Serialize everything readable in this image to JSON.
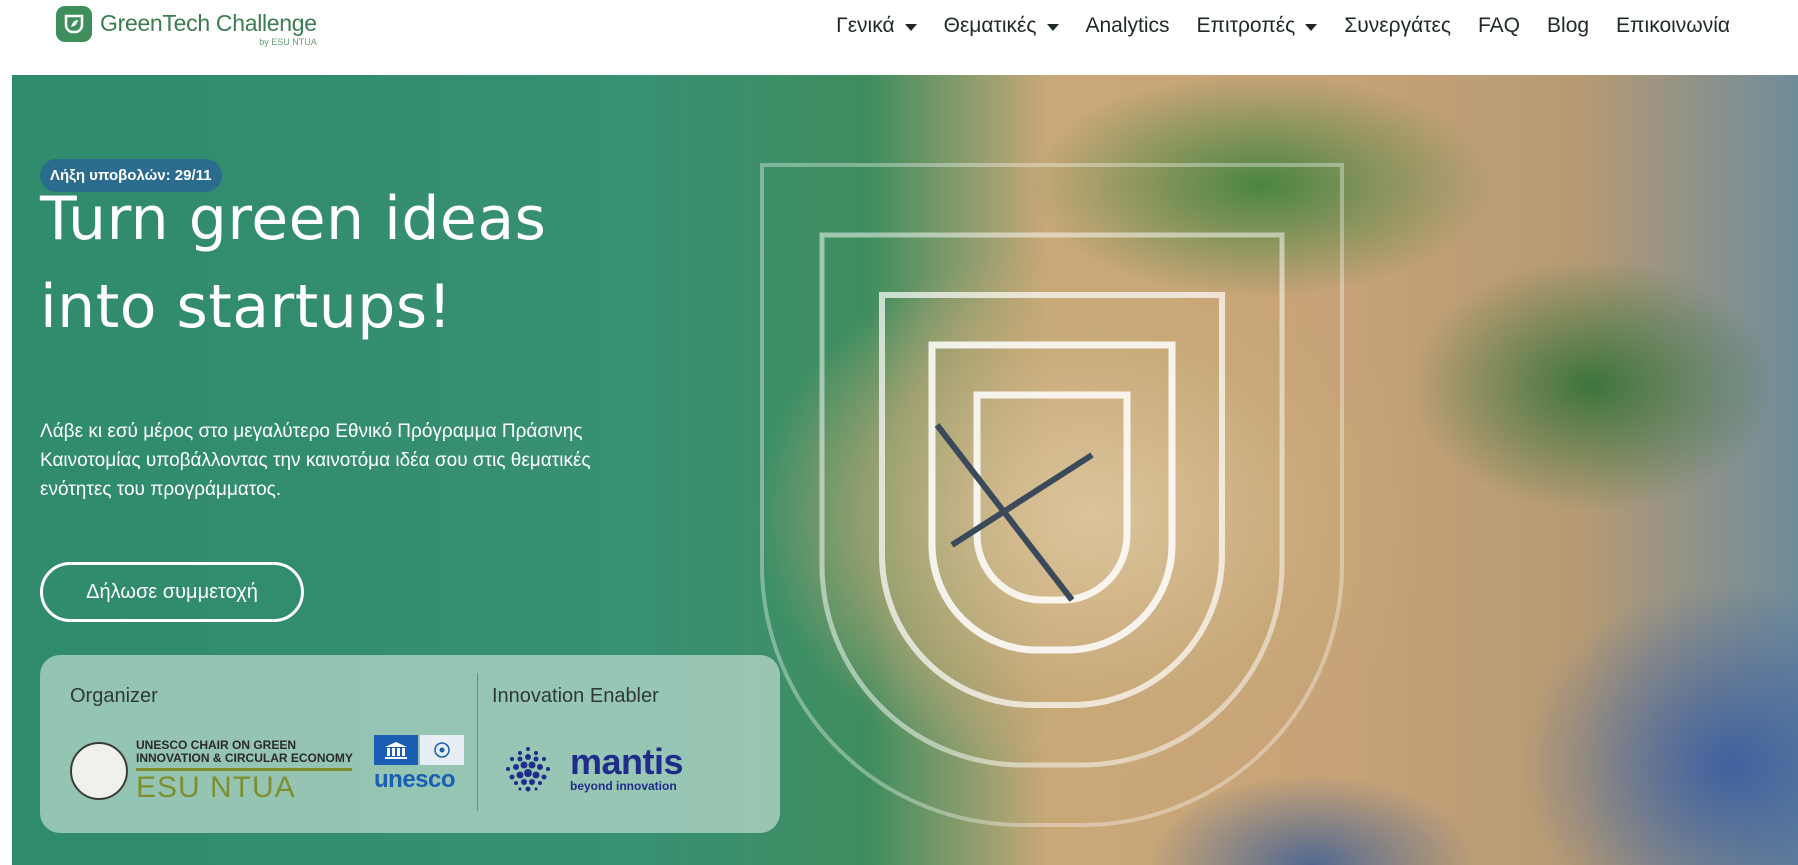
{
  "header": {
    "logo_name": "GreenTech Challenge",
    "logo_sub": "by ESU NTUA",
    "nav": [
      {
        "label": "Γενικά",
        "dropdown": true
      },
      {
        "label": "Θεματικές",
        "dropdown": true
      },
      {
        "label": "Analytics",
        "dropdown": false
      },
      {
        "label": "Επιτροπές",
        "dropdown": true
      },
      {
        "label": "Συνεργάτες",
        "dropdown": false
      },
      {
        "label": "FAQ",
        "dropdown": false
      },
      {
        "label": "Blog",
        "dropdown": false
      },
      {
        "label": "Επικοινωνία",
        "dropdown": false
      }
    ]
  },
  "hero": {
    "badge": "Λήξη υποβολών: 29/11",
    "headline_line1": "Turn green ideas",
    "headline_line2": "into startups!",
    "intro_line1": "Λάβε κι εσύ μέρος στο μεγαλύτερο Εθνικό Πρόγραμμα Πράσινης",
    "intro_line2": "Καινοτομίας υποβάλλοντας την καινοτόμα ιδέα σου στις θεματικές",
    "intro_line3": "ενότητες του προγράμματος.",
    "cta_label": "Δήλωσε συμμετοχή"
  },
  "partners": {
    "organizer_label": "Organizer",
    "enabler_label": "Innovation Enabler",
    "esu_small_1": "UNESCO CHAIR ON GREEN",
    "esu_small_2": "INNOVATION & CIRCULAR ECONOMY",
    "esu_big": "ESU NTUA",
    "unesco_word": "unesco",
    "mantis_word": "mantis",
    "mantis_sub": "beyond innovation"
  },
  "colors": {
    "brand_green": "#3a7d4f",
    "badge_blue": "#2b6c8e",
    "mantis_blue": "#1f2c8a",
    "unesco_blue": "#1a5fb4"
  }
}
